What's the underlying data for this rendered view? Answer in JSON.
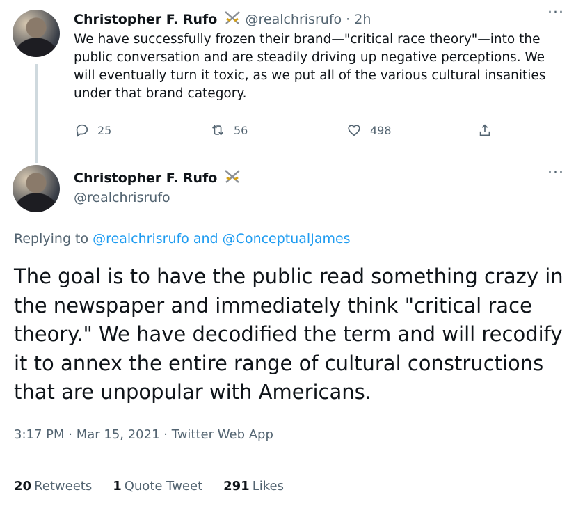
{
  "tweet1": {
    "author_name": "Christopher F. Rufo",
    "handle_time": "@realchrisrufo · 2h",
    "text": "We have successfully frozen their brand—\"critical race theory\"—into the public conversation and are steadily driving up negative perceptions. We will eventually turn it toxic, as we put all of the various cultural insanities under that brand category.",
    "more": "···",
    "replies": "25",
    "retweets": "56",
    "likes": "498"
  },
  "tweet2": {
    "author_name": "Christopher F. Rufo",
    "handle": "@realchrisrufo",
    "more": "···",
    "replying_prefix": "Replying to",
    "reply_user1": "@realchrisrufo",
    "reply_and": "and",
    "reply_user2": "@ConceptualJames",
    "text": "The goal is to have the public read something crazy in the newspaper and immediately think \"critical race theory.\" We have decodified the term and will recodify it to annex the entire range of cultural constructions that are unpopular with Americans.",
    "timestamp": "3:17 PM · Mar 15, 2021 · Twitter Web App",
    "stats": {
      "retweets_count": "20",
      "retweets_label": "Retweets",
      "quotes_count": "1",
      "quotes_label": "Quote Tweet",
      "likes_count": "291",
      "likes_label": "Likes"
    }
  },
  "colors": {
    "link": "#1d9bf0",
    "secondary_text": "#536471",
    "primary_text": "#0f1419",
    "divider": "#e1e6ea"
  },
  "icons": [
    "swords-icon",
    "more-icon",
    "reply-icon",
    "retweet-icon",
    "like-icon",
    "share-icon"
  ]
}
